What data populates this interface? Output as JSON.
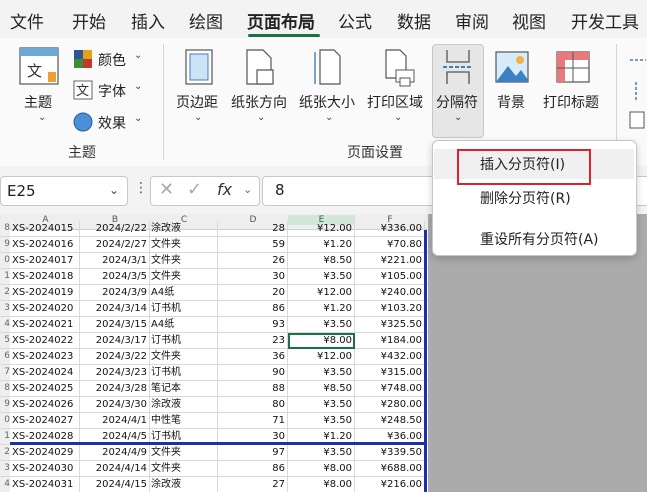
{
  "menu": {
    "tabs": [
      "文件",
      "开始",
      "插入",
      "绘图",
      "页面布局",
      "公式",
      "数据",
      "审阅",
      "视图",
      "开发工具"
    ],
    "active_index": 4
  },
  "ribbon": {
    "theme_group": {
      "theme_label": "主题",
      "colors_label": "颜色",
      "fonts_label": "字体",
      "effects_label": "效果",
      "group_label": "主题"
    },
    "page_setup": {
      "margins_label": "页边距",
      "orientation_label": "纸张方向",
      "size_label": "纸张大小",
      "print_area_label": "打印区域",
      "breaks_label": "分隔符",
      "background_label": "背景",
      "print_titles_label": "打印标题",
      "group_label": "页面设置"
    }
  },
  "formula_bar": {
    "name_box": "E25",
    "fx": "fx",
    "value": "8"
  },
  "dropdown": {
    "items": [
      "插入分页符(I)",
      "删除分页符(R)",
      "重设所有分页符(A)"
    ]
  },
  "columns": [
    "A",
    "B",
    "C",
    "D",
    "E",
    "F"
  ],
  "rows": [
    {
      "rh": "8",
      "a": "XS-2024015",
      "b": "2024/2/22",
      "c": "涂改液",
      "d": "28",
      "e": "¥12.00",
      "f": "¥336.00"
    },
    {
      "rh": "9",
      "a": "XS-2024016",
      "b": "2024/2/27",
      "c": "文件夹",
      "d": "59",
      "e": "¥1.20",
      "f": "¥70.80"
    },
    {
      "rh": "0",
      "a": "XS-2024017",
      "b": "2024/3/1",
      "c": "文件夹",
      "d": "26",
      "e": "¥8.50",
      "f": "¥221.00"
    },
    {
      "rh": "1",
      "a": "XS-2024018",
      "b": "2024/3/5",
      "c": "文件夹",
      "d": "30",
      "e": "¥3.50",
      "f": "¥105.00"
    },
    {
      "rh": "2",
      "a": "XS-2024019",
      "b": "2024/3/9",
      "c": "A4纸",
      "d": "20",
      "e": "¥12.00",
      "f": "¥240.00"
    },
    {
      "rh": "3",
      "a": "XS-2024020",
      "b": "2024/3/14",
      "c": "订书机",
      "d": "86",
      "e": "¥1.20",
      "f": "¥103.20"
    },
    {
      "rh": "4",
      "a": "XS-2024021",
      "b": "2024/3/15",
      "c": "A4纸",
      "d": "93",
      "e": "¥3.50",
      "f": "¥325.50"
    },
    {
      "rh": "5",
      "a": "XS-2024022",
      "b": "2024/3/17",
      "c": "订书机",
      "d": "23",
      "e": "¥8.00",
      "f": "¥184.00"
    },
    {
      "rh": "6",
      "a": "XS-2024023",
      "b": "2024/3/22",
      "c": "文件夹",
      "d": "36",
      "e": "¥12.00",
      "f": "¥432.00"
    },
    {
      "rh": "7",
      "a": "XS-2024024",
      "b": "2024/3/23",
      "c": "订书机",
      "d": "90",
      "e": "¥3.50",
      "f": "¥315.00"
    },
    {
      "rh": "8",
      "a": "XS-2024025",
      "b": "2024/3/28",
      "c": "笔记本",
      "d": "88",
      "e": "¥8.50",
      "f": "¥748.00"
    },
    {
      "rh": "9",
      "a": "XS-2024026",
      "b": "2024/3/30",
      "c": "涂改液",
      "d": "80",
      "e": "¥3.50",
      "f": "¥280.00"
    },
    {
      "rh": "0",
      "a": "XS-2024027",
      "b": "2024/4/1",
      "c": "中性笔",
      "d": "71",
      "e": "¥3.50",
      "f": "¥248.50"
    },
    {
      "rh": "1",
      "a": "XS-2024028",
      "b": "2024/4/5",
      "c": "订书机",
      "d": "30",
      "e": "¥1.20",
      "f": "¥36.00"
    },
    {
      "rh": "2",
      "a": "XS-2024029",
      "b": "2024/4/9",
      "c": "文件夹",
      "d": "97",
      "e": "¥3.50",
      "f": "¥339.50"
    },
    {
      "rh": "3",
      "a": "XS-2024030",
      "b": "2024/4/14",
      "c": "文件夹",
      "d": "86",
      "e": "¥8.00",
      "f": "¥688.00"
    },
    {
      "rh": "4",
      "a": "XS-2024031",
      "b": "2024/4/15",
      "c": "涂改液",
      "d": "27",
      "e": "¥8.00",
      "f": "¥216.00"
    }
  ],
  "colors": {
    "accent": "#1e7145",
    "page_break": "#1f2fa8",
    "highlight_box": "#e0222b",
    "sheet_bg": "#ababab"
  }
}
